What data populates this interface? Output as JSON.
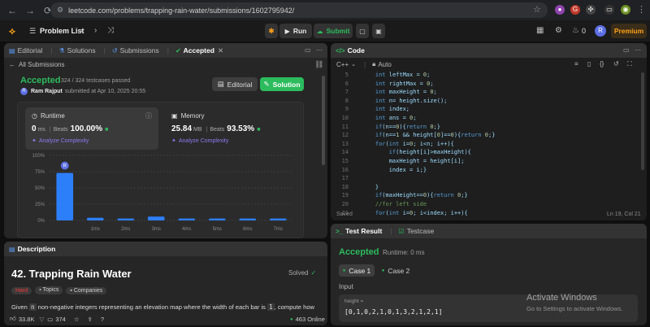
{
  "browser": {
    "url": "leetcode.com/problems/trapping-rain-water/submissions/1602795942/"
  },
  "header": {
    "problem_list": "Problem List",
    "run": "Run",
    "submit": "Submit",
    "streak": "0",
    "avatar": "R",
    "premium": "Premium"
  },
  "left_tabs": {
    "editorial": "Editorial",
    "solutions": "Solutions",
    "submissions": "Submissions",
    "accepted": "Accepted"
  },
  "submission": {
    "back": "All Submissions",
    "status": "Accepted",
    "cases": "324 / 324 testcases passed",
    "author": "Ram Rajput",
    "submitted": "submitted at Apr 10, 2025 20:55",
    "editorial_btn": "Editorial",
    "solution_btn": "Solution",
    "runtime_label": "Runtime",
    "runtime_value": "0",
    "runtime_unit": "ms",
    "runtime_beats_label": "Beats",
    "runtime_beats": "100.00%",
    "memory_label": "Memory",
    "memory_value": "25.84",
    "memory_unit": "MB",
    "memory_beats_label": "Beats",
    "memory_beats": "93.53%",
    "analyze": "Analyze Complexity",
    "analyze2": "Analyze Complexity"
  },
  "chart_data": {
    "type": "bar",
    "categories": [
      "0ms",
      "1ms",
      "2ms",
      "3ms",
      "4ms",
      "5ms",
      "6ms",
      "7ms"
    ],
    "x_tick_labels": [
      "1ms",
      "2ms",
      "3ms",
      "4ms",
      "5ms",
      "6ms",
      "7ms"
    ],
    "values": [
      73,
      4,
      3,
      6,
      3,
      3,
      3,
      3
    ],
    "y_ticks": [
      "100%",
      "75%",
      "50%",
      "25%",
      "0%"
    ],
    "ylim": [
      0,
      100
    ],
    "highlight_index": 0,
    "marker_label": "R",
    "bar_color": "#2d7ff9",
    "grid": true
  },
  "description": {
    "tab": "Description",
    "title": "42. Trapping Rain Water",
    "solved": "Solved",
    "difficulty": "Hard",
    "topics": "Topics",
    "companies": "Companies",
    "text_start": "Given ",
    "text_n": "n",
    "text_mid": " non-negative integers representing an elevation map where the width of each bar is ",
    "text_one": "1",
    "text_end": ", compute how",
    "likes": "33.8K",
    "comments": "374",
    "online": "463 Online"
  },
  "code": {
    "tab": "Code",
    "language": "C++",
    "mode": "Auto",
    "saved": "Saved",
    "cursor": "Ln 19, Col 21",
    "lines": [
      {
        "n": "5",
        "t": "    int leftMax = 0;"
      },
      {
        "n": "6",
        "t": "    int rightMax = 0;"
      },
      {
        "n": "7",
        "t": "    int maxHeight = 0;"
      },
      {
        "n": "8",
        "t": "    int n= height.size();"
      },
      {
        "n": "9",
        "t": "    int index;"
      },
      {
        "n": "10",
        "t": "    int ans = 0;"
      },
      {
        "n": "11",
        "t": "    if(n==0){return 0;}"
      },
      {
        "n": "12",
        "t": "    if(n==1 && height[0]==0){return 0;}"
      },
      {
        "n": "13",
        "t": "    for(int i=0; i<n; i++){"
      },
      {
        "n": "14",
        "t": "        if(height[i]>maxHeight){"
      },
      {
        "n": "15",
        "t": "        maxHeight = height[i];"
      },
      {
        "n": "16",
        "t": "        index = i;}"
      },
      {
        "n": "17",
        "t": ""
      },
      {
        "n": "18",
        "t": "    }"
      },
      {
        "n": "19",
        "t": "    if(maxHeight==0){return 0;}"
      },
      {
        "n": "20",
        "t": "    //for left side"
      },
      {
        "n": "21",
        "t": "    for(int i=0; i<index; i++){"
      }
    ]
  },
  "testresult": {
    "tab": "Test Result",
    "tab2": "Testcase",
    "status": "Accepted",
    "runtime": "Runtime: 0 ms",
    "case1": "Case 1",
    "case2": "Case 2",
    "input_label": "Input",
    "param": "height =",
    "value": "[0,1,0,2,1,0,1,3,2,1,2,1]"
  },
  "watermark": {
    "line1": "Activate Windows",
    "line2": "Go to Settings to activate Windows."
  }
}
